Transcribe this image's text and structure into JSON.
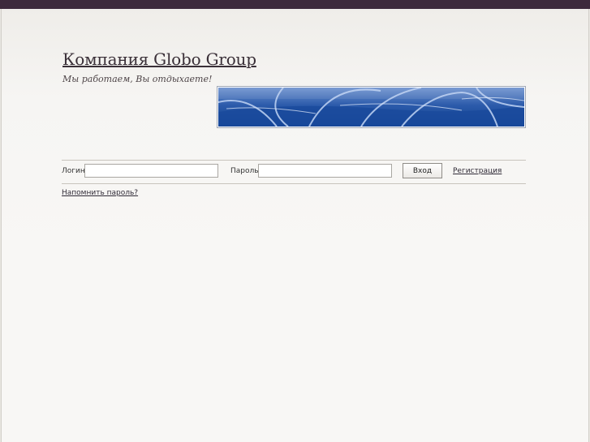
{
  "header": {
    "title": "Компания Globo Group",
    "tagline": "Мы работаем, Вы отдыхаете!"
  },
  "login_form": {
    "login_label": "Логин:",
    "login_value": "",
    "password_label": "Пароль:",
    "password_value": "",
    "submit_label": "Вход",
    "register_link": "Регистрация",
    "remind_link": "Напомнить пароль?"
  },
  "colors": {
    "topbar": "#3d2a3c",
    "banner_blue": "#1f4fa3"
  }
}
